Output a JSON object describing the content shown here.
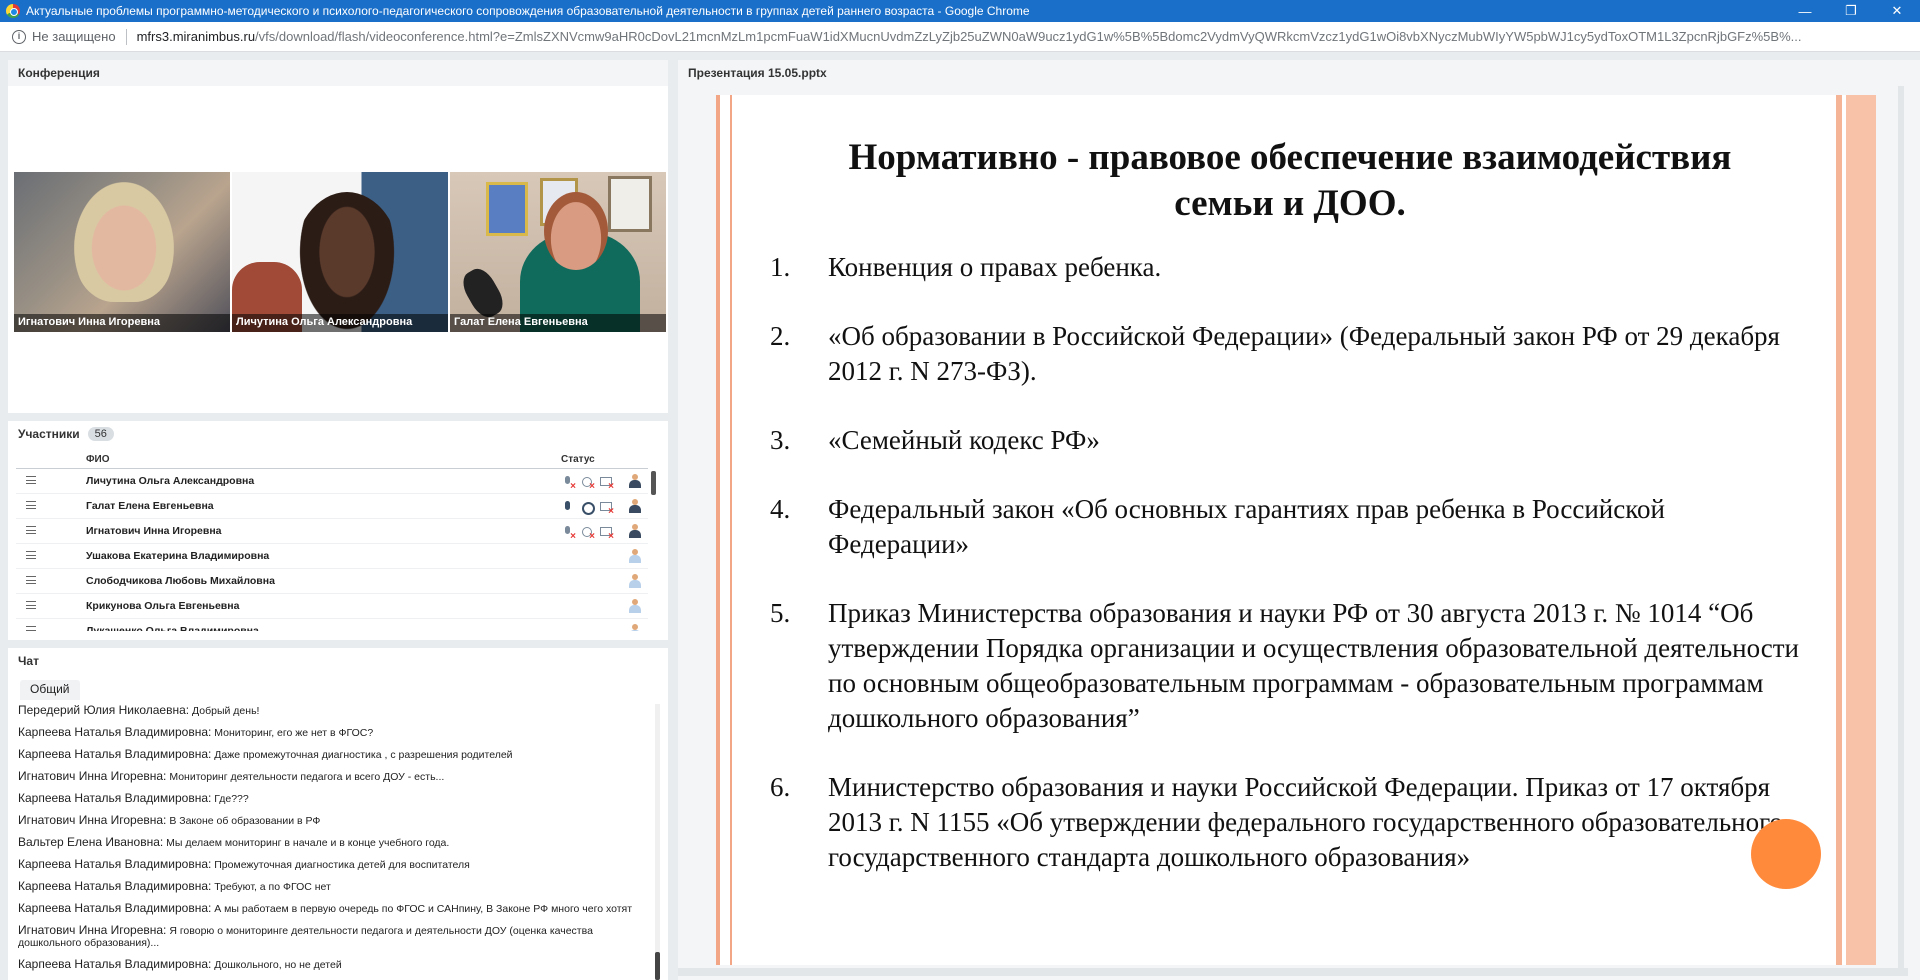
{
  "window": {
    "title": "Актуальные проблемы программно-методического и психолого-педагогического сопровождения образовательной деятельности в группах детей раннего возраста - Google Chrome",
    "controls": {
      "minimize": "—",
      "restore": "❐",
      "close": "✕"
    }
  },
  "address_bar": {
    "security": "Не защищено",
    "host": "mfrs3.miranimbus.ru",
    "path": "/vfs/download/flash/videoconference.html?e=ZmlsZXNVcmw9aHR0cDovL21mcnMzLm1pcmFuaW1idXMucnUvdmZzLyZjb25uZWN0aW9ucz1ydG1w%5B%5Bdomc2VydmVyQWRkcmVzcz1ydG1wOi8vbXNyczMubWIyYW5pbWJ1cy5ydToxOTM1L3ZpcnRjbGFz%5B%..."
  },
  "conference": {
    "title": "Конференция",
    "videos": [
      {
        "name": "Игнатович  Инна Игоревна"
      },
      {
        "name": "Личутина  Ольга Александровна"
      },
      {
        "name": "Галат Елена  Евгеньевна"
      }
    ]
  },
  "participants": {
    "title": "Участники",
    "count": "56",
    "col_name": "ФИО",
    "col_status": "Статус",
    "rows": [
      {
        "name": "Личутина  Ольга Александровна",
        "mic": "off",
        "cam": "off",
        "screen": "off",
        "role": "speaker"
      },
      {
        "name": "Галат Елена  Евгеньевна",
        "mic": "on",
        "cam": "on",
        "screen": "off",
        "role": "speaker"
      },
      {
        "name": "Игнатович  Инна Игоревна",
        "mic": "off",
        "cam": "off",
        "screen": "off",
        "role": "speaker"
      },
      {
        "name": "Ушакова Екатерина Владимировна",
        "role": "listener"
      },
      {
        "name": "Слободчикова  Любовь Михайловна",
        "role": "listener"
      },
      {
        "name": "Крикунова Ольга Евгеньевна",
        "role": "listener"
      },
      {
        "name": "Лукашенко Ольга Владимировна",
        "role": "listener"
      }
    ]
  },
  "chat": {
    "title": "Чат",
    "tab": "Общий",
    "messages": [
      {
        "author": "Передерий Юлия Николаевна:",
        "text": "Добрый день!"
      },
      {
        "author": "Карпеева Наталья  Владимировна:",
        "text": "Мониторинг, его же нет в ФГОС?"
      },
      {
        "author": "Карпеева Наталья  Владимировна:",
        "text": "Даже промежуточная диагностика , с разрешения родителей"
      },
      {
        "author": "Игнатович  Инна Игоревна:",
        "text": "Мониторинг деятельности педагога  и всего ДОУ - есть..."
      },
      {
        "author": "Карпеева Наталья  Владимировна:",
        "text": "Где???"
      },
      {
        "author": "Игнатович  Инна Игоревна:",
        "text": "В Законе об образовании в РФ"
      },
      {
        "author": "Вальтер Елена Ивановна:",
        "text": "Мы делаем мониторинг в начале и в конце учебного года."
      },
      {
        "author": "Карпеева Наталья  Владимировна:",
        "text": "Промежуточная диагностика детей для воспитателя"
      },
      {
        "author": "Карпеева Наталья  Владимировна:",
        "text": "Требуют, а по ФГОС нет"
      },
      {
        "author": "Карпеева Наталья  Владимировна:",
        "text": "А мы работаем в первую очередь по ФГОС и САНпину, В Законе РФ много чего хотят"
      },
      {
        "author": "Игнатович  Инна Игоревна:",
        "text": "Я говорю о мониторинге деятельности педагога и деятельности ДОУ (оценка качества   дошкольного образования)..."
      },
      {
        "author": "Карпеева Наталья  Владимировна:",
        "text": "Дошкольного, но не детей"
      }
    ]
  },
  "presentation": {
    "title": "Презентация 15.05.pptx",
    "slide_title_line1": "Нормативно - правовое обеспечение взаимодействия",
    "slide_title_line2": "семьи и ДОО.",
    "items": [
      {
        "num": "1.",
        "text": "Конвенция о правах ребенка."
      },
      {
        "num": "2.",
        "text": "«Об образовании в Российской Федерации» (Федеральный закон РФ от 29 декабря 2012 г. N 273-ФЗ)."
      },
      {
        "num": "3.",
        "text": "«Семейный кодекс РФ»"
      },
      {
        "num": "4.",
        "text": "Федеральный закон «Об основных гарантиях прав ребенка в Российской Федерации»"
      },
      {
        "num": "5.",
        "text": "Приказ Министерства образования и науки РФ от 30 августа 2013 г. № 1014 “Об утверждении Порядка организации и осуществления образовательной деятельности по основным общеобразовательным программам - образовательным программам дошкольного образования”"
      },
      {
        "num": "6.",
        "text": "Министерство образования и науки Российской Федерации. Приказ от 17 октября 2013 г. N 1155 «Об утверждении федерального государственного образовательного государственного стандарта дошкольного образования»"
      }
    ]
  }
}
